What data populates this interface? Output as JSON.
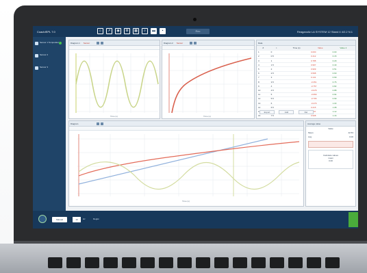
{
  "app": {
    "title": "Coach/EPL 7.0",
    "company": "Reaganoliz LA SYSTEM 12 Stand 4 4/2.2 N.1"
  },
  "toolbar": {
    "icons": [
      "home-icon",
      "chart-icon",
      "camera-icon",
      "settings-icon",
      "table-icon",
      "zoom-icon",
      "folder-icon",
      "save-icon"
    ],
    "record_label": "Rec"
  },
  "sidebar": {
    "items": [
      {
        "label": "Sensor 1 Temperatur"
      },
      {
        "label": "Sensor 2"
      },
      {
        "label": "Sensor 3"
      }
    ]
  },
  "panels": {
    "graph1": {
      "title": "Diagram 1",
      "chip": "Sensor",
      "x_caption": "Time (s)"
    },
    "graph2": {
      "title": "Diagram 2",
      "chip": "Sensor",
      "x_caption": "Time (s)"
    },
    "table": {
      "title": "Data",
      "col_headers": [
        "#",
        "t",
        "Time (s)",
        "Value",
        "Value 2"
      ],
      "buttons": [
        "Export",
        "Add",
        "Del"
      ]
    },
    "graph3": {
      "title": "Diagram",
      "x_caption": "Time (s)"
    },
    "average": {
      "title": "Average value",
      "header": "Value",
      "row1_label": "Mean",
      "row1_value": "42.53",
      "row2_label": "Avg",
      "row2_value": "0.00",
      "footer_title": "Calculate values",
      "footer_lines": [
        "mean",
        "0.00"
      ]
    }
  },
  "table_rows": [
    {
      "n": "1",
      "v1": "0",
      "v2": "0.000",
      "v3": "0.00"
    },
    {
      "n": "2",
      "v1": "0.5",
      "v2": "0.412",
      "v3": "0.15"
    },
    {
      "n": "3",
      "v1": "1",
      "v2": "0.788",
      "v3": "0.29"
    },
    {
      "n": "4",
      "v1": "1.5",
      "v2": "0.997",
      "v3": "0.40"
    },
    {
      "n": "5",
      "v1": "2",
      "v2": "0.909",
      "v3": "0.51"
    },
    {
      "n": "6",
      "v1": "2.5",
      "v2": "0.598",
      "v3": "0.60"
    },
    {
      "n": "7",
      "v1": "3",
      "v2": "0.141",
      "v3": "0.69"
    },
    {
      "n": "8",
      "v1": "3.5",
      "v2": "-0.351",
      "v3": "0.76"
    },
    {
      "n": "9",
      "v1": "4",
      "v2": "-0.757",
      "v3": "0.82"
    },
    {
      "n": "10",
      "v1": "4.5",
      "v2": "-0.978",
      "v3": "0.88"
    },
    {
      "n": "11",
      "v1": "5",
      "v2": "-0.959",
      "v3": "0.94"
    },
    {
      "n": "12",
      "v1": "5.5",
      "v2": "-0.706",
      "v3": "0.99"
    },
    {
      "n": "13",
      "v1": "6",
      "v2": "-0.279",
      "v3": "1.03"
    },
    {
      "n": "14",
      "v1": "6.5",
      "v2": "0.215",
      "v3": "1.08"
    },
    {
      "n": "15",
      "v1": "7",
      "v2": "0.657",
      "v3": "1.12"
    },
    {
      "n": "16",
      "v1": "7.5",
      "v2": "0.938",
      "v3": "1.16"
    }
  ],
  "bottombar": {
    "mode_label": "Manual",
    "rate_value": "10",
    "rate_unit": "Hz",
    "registration_label": "Regist"
  }
}
